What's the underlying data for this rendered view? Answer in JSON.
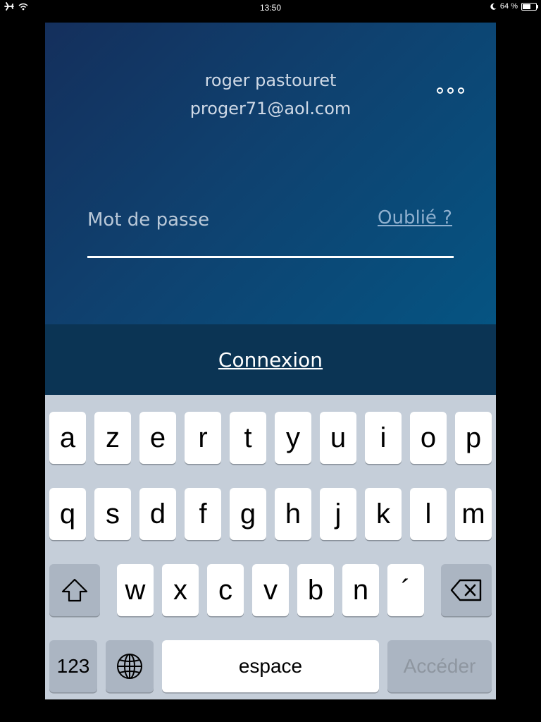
{
  "status_bar": {
    "time": "13:50",
    "battery_percent": "64 %",
    "battery_level": 0.64
  },
  "account": {
    "name": "roger pastouret",
    "email": "proger71@aol.com"
  },
  "password": {
    "placeholder": "Mot de passe",
    "value": "",
    "forgot_label": "Oublié ?"
  },
  "connect_label": "Connexion",
  "keyboard": {
    "row1": [
      "a",
      "z",
      "e",
      "r",
      "t",
      "y",
      "u",
      "i",
      "o",
      "p"
    ],
    "row2": [
      "q",
      "s",
      "d",
      "f",
      "g",
      "h",
      "j",
      "k",
      "l",
      "m"
    ],
    "row3": [
      "w",
      "x",
      "c",
      "v",
      "b",
      "n",
      "´"
    ],
    "numbers_label": "123",
    "space_label": "espace",
    "go_label": "Accéder"
  },
  "colors": {
    "hero_start": "#142f5c",
    "hero_end": "#055482",
    "connect_bg": "#0b3454",
    "keyboard_bg": "#c5ced9"
  },
  "icons": [
    "airplane-icon",
    "wifi-icon",
    "moon-icon",
    "battery-icon",
    "more-options-icon",
    "shift-icon",
    "backspace-icon",
    "globe-icon"
  ]
}
